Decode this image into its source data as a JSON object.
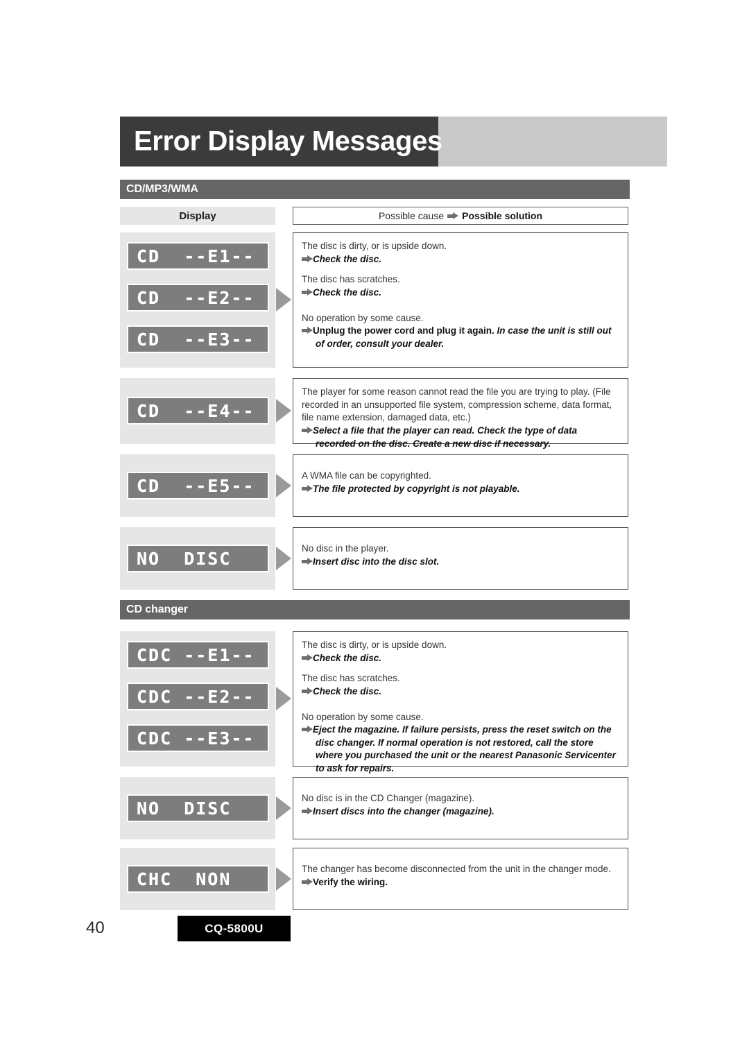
{
  "page": {
    "title": "Error Display Messages",
    "page_number": "40",
    "model": "CQ-5800U"
  },
  "columns": {
    "display_header": "Display",
    "cause_label": "Possible cause",
    "solution_label": "Possible solution",
    "arrow_icon": "right-arrow-icon"
  },
  "sections": [
    {
      "id": "cd-mp3-wma",
      "title": "CD/MP3/WMA",
      "rows": [
        {
          "displays": [
            "CD  --E1--",
            "CD  --E2--",
            "CD  --E3--"
          ],
          "entries": [
            {
              "cause": "The disc is dirty, or is upside down.",
              "solution": "Check the disc.",
              "style": "italic"
            },
            {
              "cause": "The disc has scratches.",
              "solution": "Check the disc.",
              "style": "italic"
            },
            {
              "cause": "No operation by some cause.",
              "solution_bold_upright": "Unplug the power cord and plug it again.",
              "solution_bold_italic": "In case the unit is still out of order, consult your dealer.",
              "style": "mixed"
            }
          ]
        },
        {
          "displays": [
            "CD  --E4--"
          ],
          "entries": [
            {
              "cause": "The player for some reason cannot read the file you are trying to play. (File recorded in an unsupported file system, compression scheme, data format, file name extension, damaged data, etc.)",
              "solution": "Select a file that the player can read. Check the type of data recorded on the disc. Create a new disc if necessary.",
              "style": "italic"
            }
          ]
        },
        {
          "displays": [
            "CD  --E5--"
          ],
          "entries": [
            {
              "cause": "A WMA file can be copyrighted.",
              "solution": "The file protected by copyright is not playable.",
              "style": "italic"
            }
          ]
        },
        {
          "displays": [
            "NO  DISC"
          ],
          "entries": [
            {
              "cause": "No disc in the player.",
              "solution": "Insert disc into the disc slot.",
              "style": "italic"
            }
          ]
        }
      ]
    },
    {
      "id": "cd-changer",
      "title": "CD changer",
      "rows": [
        {
          "displays": [
            "CDC --E1--",
            "CDC --E2--",
            "CDC --E3--"
          ],
          "entries": [
            {
              "cause": "The disc is dirty, or is upside down.",
              "solution": "Check the disc.",
              "style": "italic"
            },
            {
              "cause": "The disc has scratches.",
              "solution": "Check the disc.",
              "style": "italic"
            },
            {
              "cause": "No operation by some cause.",
              "solution": "Eject the magazine. If failure persists, press the reset switch on the disc changer. If normal operation is not restored, call the store where you purchased the unit or the nearest Panasonic Servicenter to ask for repairs.",
              "style": "italic"
            }
          ]
        },
        {
          "displays": [
            "NO  DISC"
          ],
          "entries": [
            {
              "cause": "No disc is in the CD Changer (magazine).",
              "solution": "Insert discs into the changer (magazine).",
              "style": "italic"
            }
          ]
        },
        {
          "displays": [
            "CHC  NON"
          ],
          "entries": [
            {
              "cause": "The changer has become disconnected from the unit in the changer mode.",
              "solution": "Verify the wiring.",
              "style": "upright"
            }
          ]
        }
      ]
    }
  ]
}
